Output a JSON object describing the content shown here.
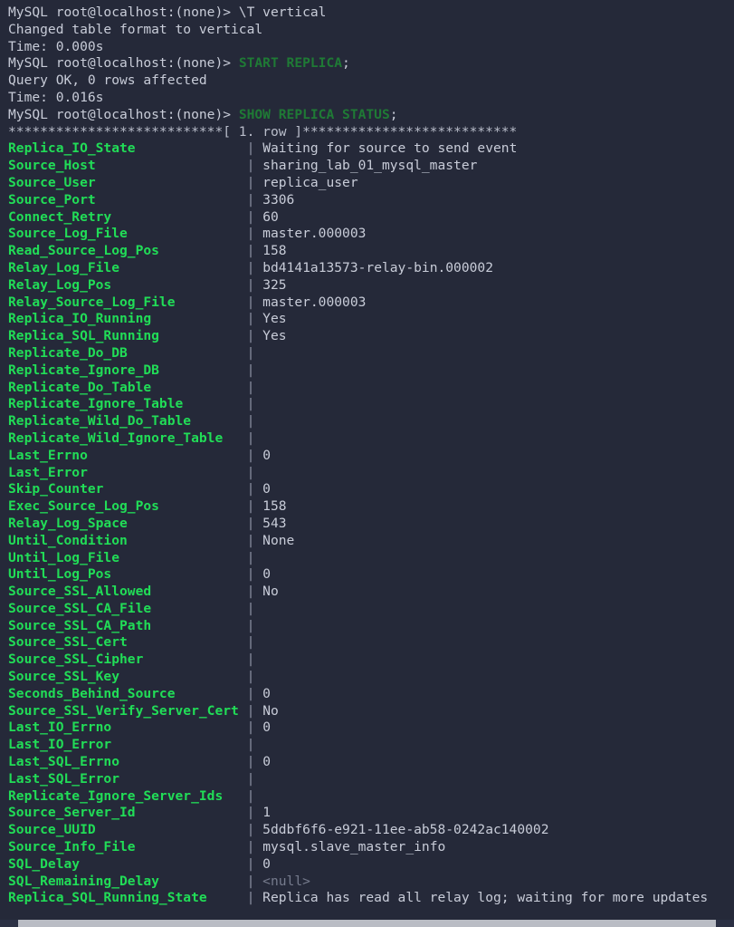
{
  "terminal": {
    "background_color": "#252939",
    "foreground_color": "#c8ccd8",
    "field_name_color": "#21dd57",
    "keyword_color": "#1f7a35",
    "null_color": "#767b8d",
    "pipe_color": "#8b90a3",
    "prompt": "MySQL root@localhost:(none)>",
    "pipe_char": "|"
  },
  "session": [
    {
      "type": "command",
      "prompt": "MySQL root@localhost:(none)>",
      "keyword": "",
      "rest": " \\T vertical",
      "punct": ""
    },
    {
      "type": "output",
      "text": "Changed table format to vertical"
    },
    {
      "type": "output",
      "text": "Time: 0.000s"
    },
    {
      "type": "command",
      "prompt": "MySQL root@localhost:(none)>",
      "keyword": "START REPLICA",
      "rest": " ",
      "punct": ";"
    },
    {
      "type": "output",
      "text": "Query OK, 0 rows affected"
    },
    {
      "type": "output",
      "text": "Time: 0.016s"
    },
    {
      "type": "command",
      "prompt": "MySQL root@localhost:(none)>",
      "keyword": "SHOW REPLICA STATUS",
      "rest": " ",
      "punct": ";"
    }
  ],
  "result": {
    "row_separator": "***************************[ 1. row ]***************************",
    "row_separator_label": "1. row",
    "field_column_width": 30,
    "fields": [
      {
        "name": "Replica_IO_State",
        "value": "Waiting for source to send event",
        "null": false
      },
      {
        "name": "Source_Host",
        "value": "sharing_lab_01_mysql_master",
        "null": false
      },
      {
        "name": "Source_User",
        "value": "replica_user",
        "null": false
      },
      {
        "name": "Source_Port",
        "value": "3306",
        "null": false
      },
      {
        "name": "Connect_Retry",
        "value": "60",
        "null": false
      },
      {
        "name": "Source_Log_File",
        "value": "master.000003",
        "null": false
      },
      {
        "name": "Read_Source_Log_Pos",
        "value": "158",
        "null": false
      },
      {
        "name": "Relay_Log_File",
        "value": "bd4141a13573-relay-bin.000002",
        "null": false
      },
      {
        "name": "Relay_Log_Pos",
        "value": "325",
        "null": false
      },
      {
        "name": "Relay_Source_Log_File",
        "value": "master.000003",
        "null": false
      },
      {
        "name": "Replica_IO_Running",
        "value": "Yes",
        "null": false
      },
      {
        "name": "Replica_SQL_Running",
        "value": "Yes",
        "null": false
      },
      {
        "name": "Replicate_Do_DB",
        "value": "",
        "null": false
      },
      {
        "name": "Replicate_Ignore_DB",
        "value": "",
        "null": false
      },
      {
        "name": "Replicate_Do_Table",
        "value": "",
        "null": false
      },
      {
        "name": "Replicate_Ignore_Table",
        "value": "",
        "null": false
      },
      {
        "name": "Replicate_Wild_Do_Table",
        "value": "",
        "null": false
      },
      {
        "name": "Replicate_Wild_Ignore_Table",
        "value": "",
        "null": false
      },
      {
        "name": "Last_Errno",
        "value": "0",
        "null": false
      },
      {
        "name": "Last_Error",
        "value": "",
        "null": false
      },
      {
        "name": "Skip_Counter",
        "value": "0",
        "null": false
      },
      {
        "name": "Exec_Source_Log_Pos",
        "value": "158",
        "null": false
      },
      {
        "name": "Relay_Log_Space",
        "value": "543",
        "null": false
      },
      {
        "name": "Until_Condition",
        "value": "None",
        "null": false
      },
      {
        "name": "Until_Log_File",
        "value": "",
        "null": false
      },
      {
        "name": "Until_Log_Pos",
        "value": "0",
        "null": false
      },
      {
        "name": "Source_SSL_Allowed",
        "value": "No",
        "null": false
      },
      {
        "name": "Source_SSL_CA_File",
        "value": "",
        "null": false
      },
      {
        "name": "Source_SSL_CA_Path",
        "value": "",
        "null": false
      },
      {
        "name": "Source_SSL_Cert",
        "value": "",
        "null": false
      },
      {
        "name": "Source_SSL_Cipher",
        "value": "",
        "null": false
      },
      {
        "name": "Source_SSL_Key",
        "value": "",
        "null": false
      },
      {
        "name": "Seconds_Behind_Source",
        "value": "0",
        "null": false
      },
      {
        "name": "Source_SSL_Verify_Server_Cert",
        "value": "No",
        "null": false
      },
      {
        "name": "Last_IO_Errno",
        "value": "0",
        "null": false
      },
      {
        "name": "Last_IO_Error",
        "value": "",
        "null": false
      },
      {
        "name": "Last_SQL_Errno",
        "value": "0",
        "null": false
      },
      {
        "name": "Last_SQL_Error",
        "value": "",
        "null": false
      },
      {
        "name": "Replicate_Ignore_Server_Ids",
        "value": "",
        "null": false
      },
      {
        "name": "Source_Server_Id",
        "value": "1",
        "null": false
      },
      {
        "name": "Source_UUID",
        "value": "5ddbf6f6-e921-11ee-ab58-0242ac140002",
        "null": false
      },
      {
        "name": "Source_Info_File",
        "value": "mysql.slave_master_info",
        "null": false
      },
      {
        "name": "SQL_Delay",
        "value": "0",
        "null": false
      },
      {
        "name": "SQL_Remaining_Delay",
        "value": "<null>",
        "null": true
      },
      {
        "name": "Replica_SQL_Running_State",
        "value": "Replica has read all relay log; waiting for more updates",
        "null": false
      }
    ]
  },
  "scrollbar": {
    "orientation": "horizontal",
    "thumb_left_pct": 2.5,
    "thumb_width_pct": 95
  }
}
